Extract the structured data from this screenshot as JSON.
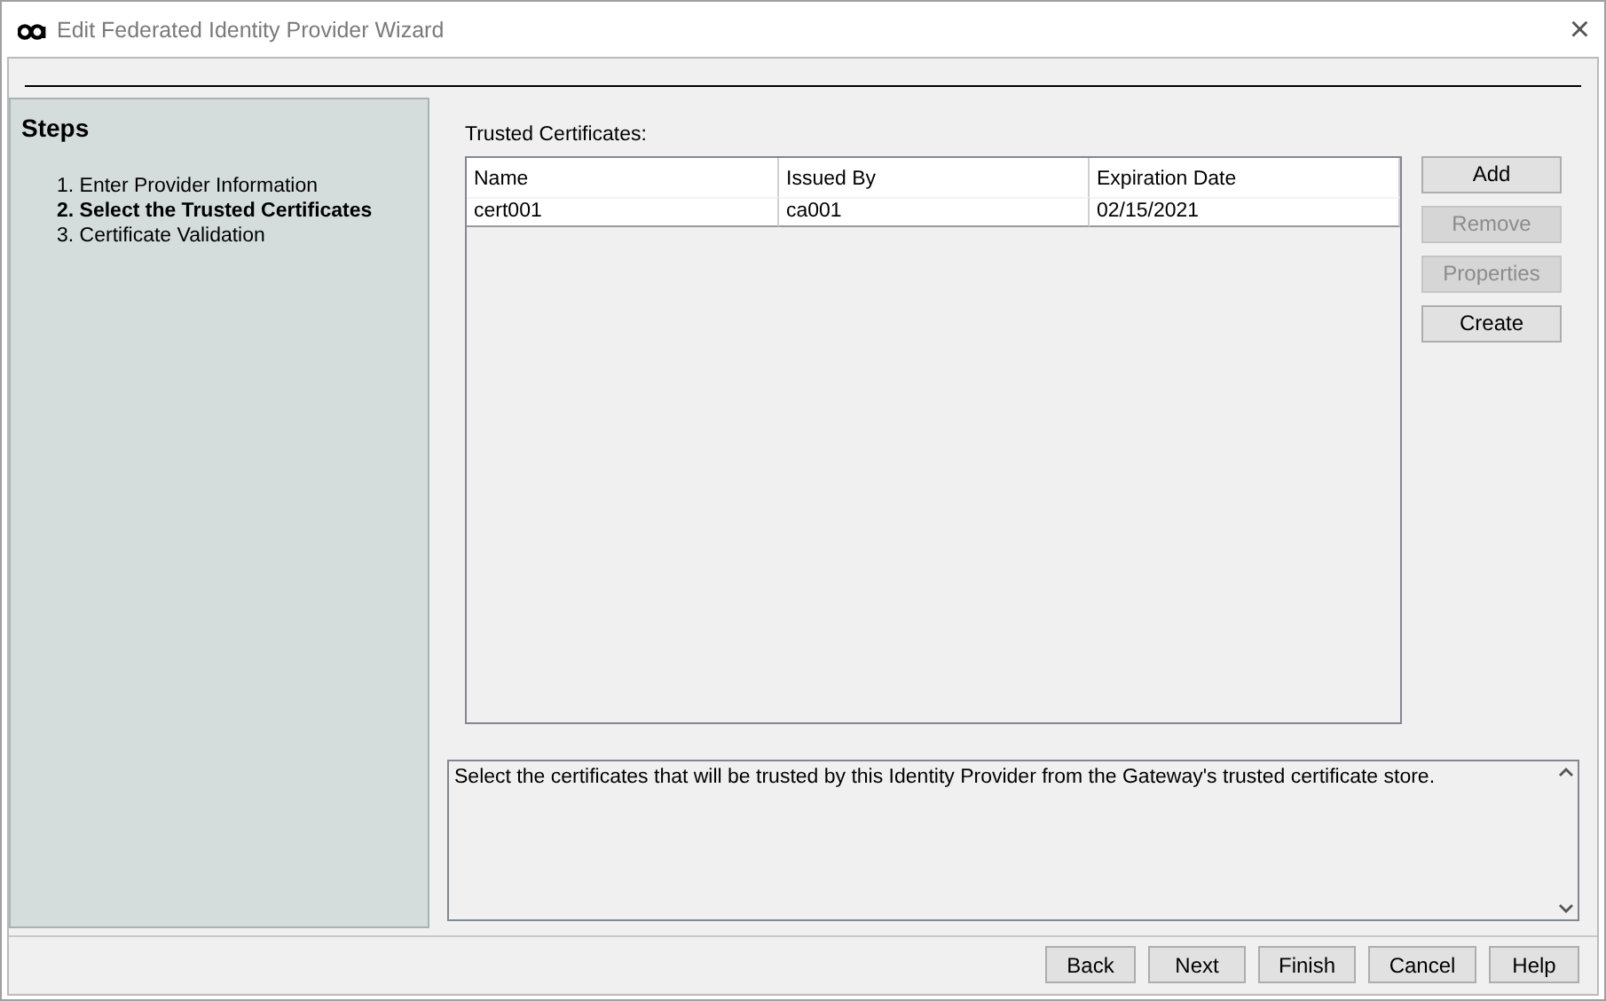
{
  "window": {
    "title": "Edit Federated Identity Provider Wizard",
    "close": "×"
  },
  "steps": {
    "title": "Steps",
    "items": [
      {
        "label": "1. Enter Provider Information",
        "selected": false
      },
      {
        "label": "2. Select the Trusted Certificates",
        "selected": true
      },
      {
        "label": "3. Certificate Validation",
        "selected": false
      }
    ]
  },
  "certificates": {
    "label": "Trusted Certificates:",
    "columns": [
      "Name",
      "Issued By",
      "Expiration Date"
    ],
    "rows": [
      [
        "cert001",
        "ca001",
        "02/15/2021"
      ]
    ]
  },
  "side_buttons": [
    {
      "label": "Add",
      "disabled": false
    },
    {
      "label": "Remove",
      "disabled": true
    },
    {
      "label": "Properties",
      "disabled": true
    },
    {
      "label": "Create",
      "disabled": false
    }
  ],
  "description": "Select the certificates that will be trusted by this Identity Provider from the Gateway's trusted certificate store.",
  "footer_buttons": [
    {
      "label": "Back",
      "disabled": false
    },
    {
      "label": "Next",
      "disabled": false
    },
    {
      "label": "Finish",
      "disabled": false
    },
    {
      "label": "Cancel",
      "disabled": false
    },
    {
      "label": "Help",
      "disabled": false
    }
  ]
}
